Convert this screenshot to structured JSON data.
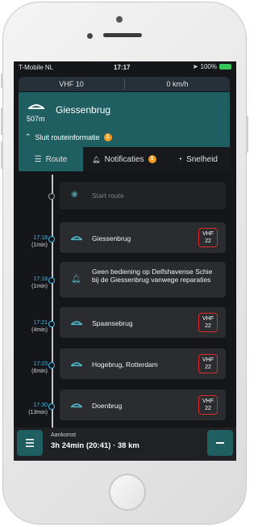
{
  "status_bar": {
    "carrier": "T-Mobile NL",
    "time": "17:17",
    "battery": "100%"
  },
  "top_bar": {
    "channel": "VHF 10",
    "speed": "0 km/h"
  },
  "next_bridge": {
    "distance": "507m",
    "name": "Giessenbrug",
    "icon": "bridge-icon"
  },
  "route_info_toggle": {
    "label": "Sluit routeinformatie",
    "badge": "1"
  },
  "tabs": [
    {
      "label": "Route",
      "icon": "list-icon",
      "active": true
    },
    {
      "label": "Notificaties",
      "icon": "bell-icon",
      "badge": "1"
    },
    {
      "label": "Snelheid",
      "icon": "speedometer-icon"
    }
  ],
  "route": {
    "start_label": "Start route",
    "items": [
      {
        "time": "17:18",
        "duration": "(1min)",
        "type": "bridge",
        "label": "Giessenbrug",
        "vhf": "VHF",
        "vhf_channel": "22"
      },
      {
        "time": "17:18",
        "duration": "(1min)",
        "type": "notification",
        "label": "Geen bediening op Delfshavense Schie bij de Giessenbrug vanwege reparaties"
      },
      {
        "time": "17:21",
        "duration": "(4min)",
        "type": "bridge",
        "label": "Spaansebrug",
        "vhf": "VHF",
        "vhf_channel": "22"
      },
      {
        "time": "17:23",
        "duration": "(6min)",
        "type": "bridge",
        "label": "Hogebrug, Rotterdam",
        "vhf": "VHF",
        "vhf_channel": "22"
      },
      {
        "time": "17:30",
        "duration": "(13min)",
        "type": "bridge",
        "label": "Doenbrug",
        "vhf": "VHF",
        "vhf_channel": "22"
      }
    ]
  },
  "bottom_bar": {
    "arrival_label": "Aankomst",
    "arrival_value": "3h 24min  (20:41) · 38 km"
  },
  "colors": {
    "accent_teal": "#1f5e61",
    "time_blue": "#3fb6e6",
    "badge_orange": "#f39c23",
    "vhf_red": "#d82c2c"
  }
}
